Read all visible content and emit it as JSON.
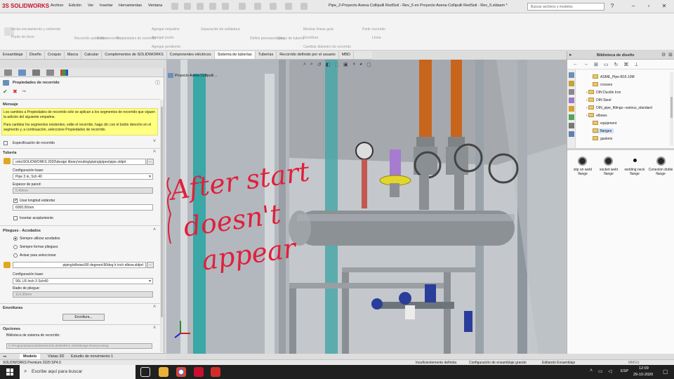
{
  "app": {
    "logo": "SOLIDWORKS",
    "logo_prefix": "3S"
  },
  "menu": [
    "Archivo",
    "Edición",
    "Ver",
    "Insertar",
    "Herramientas",
    "Ventana"
  ],
  "window_title": "Pipe_2-Proyecto Avena Collipulli RedSoil - Rev_5 en Proyecto Avena Collipulli RedSoil - Rev_5.sldasm *",
  "search_placeholder": "Buscar archivos y modelos",
  "ribbon": {
    "items": [
      "Iniciar enrutamiento y volviendo",
      "Punto de inicio",
      "Recorrido automático",
      "Editar recorrido",
      "Propiedades de recorrido",
      "Agregar empalme",
      "Agregar punto",
      "Agregar pendiente",
      "Separación de soldadura",
      "Definir prensaestopas",
      "Dibujo de tubería",
      "Mostrar líneas guía",
      "Envoltura",
      "Cambiar diámetro de recorrido",
      "Partir recorrido",
      "Línea"
    ]
  },
  "command_tabs": [
    "Ensamblaje",
    "Diseño",
    "Croquis",
    "Marca",
    "Calcular",
    "Complementos de SOLIDWORKS",
    "Componentes eléctricos",
    "Sistema de tuberías",
    "Tuberías",
    "Recorrido definido por el usuario",
    "MBD"
  ],
  "active_tab": "Sistema de tuberías",
  "property_manager": {
    "title": "Propiedades de recorrido",
    "mensaje_header": "Mensaje",
    "mensaje_1": "Los cambios a Propiedades de recorrido sólo se aplican a los segmentos de recorrido que siguen la adición del siguiente empalme.",
    "mensaje_2": "Para cambiar los segmentos existentes, edite el recorrido, haga clic con el botón derecho en el segmento y, a continuación, seleccione Propiedades de recorrido.",
    "especificacion": "Especificación de recorrido",
    "tuberia_header": "Tubería",
    "pipe_path": "orks\\SOLIDWORKS 2020\\design library\\routing\\piping\\pipes\\pipe.sldprt",
    "config_label": "Configuración base:",
    "config_value": "Pipe 3 in, Sch 40",
    "espesor_label": "Espesor de pared:",
    "espesor_value": "5.49mm",
    "usar_longitud": "Usar longitud estándar",
    "longitud_value": "6000.00mm",
    "insertar_acoplamiento": "Insertar acoplamiento",
    "pliegues_header": "Pliegues - Acodados",
    "radio1": "Siempre utilizar acodados",
    "radio2": "Siempre formar pliegues",
    "radio3": "Avisar para seleccionar",
    "elbow_path": "piping\\elbows\\90 degrees\\90deg lr inch elbow.sldprt",
    "config2_value": "90L LR Inch 3 Sch40",
    "radio_pliegue_label": "Radio de pliegue:",
    "radio_pliegue_value": "114.30mm",
    "envolturas_header": "Envolturas",
    "envoltura_button": "Envoltura...",
    "opciones_header": "Opciones",
    "biblioteca_label": "Biblioteca de sistema de recorrido:",
    "biblioteca_path": "C:\\ProgramData\\SolidWorks\\SOLIDWORKS 2020\\design library\\routing"
  },
  "viewport": {
    "tree_label": "Proyecto Avena Collipulli ..."
  },
  "annotation": {
    "line1": "After start",
    "line2": "doesn't",
    "line3": "appear"
  },
  "design_library": {
    "title": "Biblioteca de diseño",
    "tree": [
      "ASME_Pipe-B16.10M",
      "crosses",
      "DIN Ductile Iron",
      "DIN Steel",
      "DIN_pipe_fittings--various_standard",
      "elbows",
      "equipment",
      "flanges",
      "gaskets"
    ],
    "selected": "flanges",
    "items": [
      "slip on weld flange",
      "socket weld flange",
      "welding neck flange",
      "Conexión doble flange"
    ]
  },
  "bottom_tabs": [
    "Modelo",
    "Vistas 3D",
    "Estudio de movimiento 1"
  ],
  "status": {
    "left": "SOLIDWORKS Premium 2020 SP4.0",
    "s1": "Insuficientemente definida",
    "s2": "Configuración de ensamblaje grande",
    "s3": "Editando Ensamblaje",
    "units": "MMGS"
  },
  "taskbar": {
    "search": "Escribe aquí para buscar",
    "lang": "ESP",
    "time": "12:09",
    "date": "29-10-2020"
  },
  "colors": {
    "accent": "#c8102e",
    "annotation": "#e0203a",
    "message_bg": "#ffff80"
  }
}
